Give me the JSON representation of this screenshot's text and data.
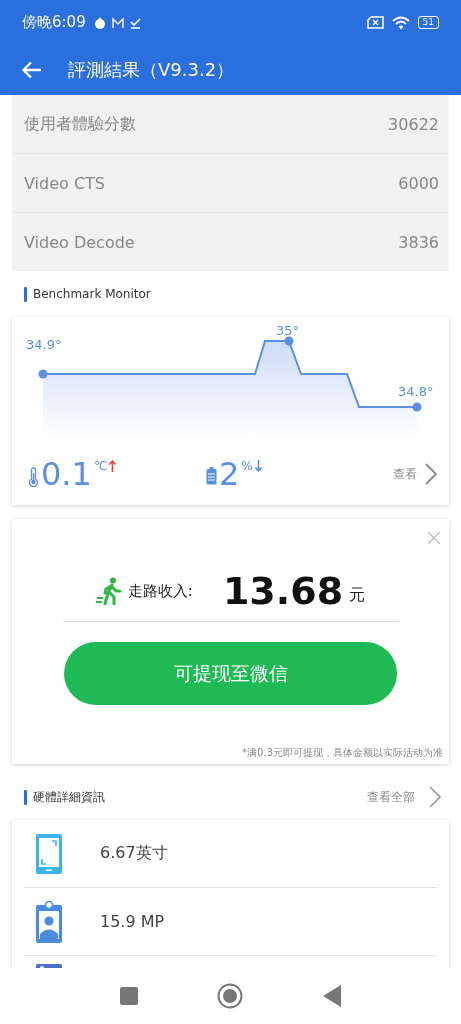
{
  "status_bar": {
    "time": "傍晚6:09",
    "battery": "51"
  },
  "app_bar": {
    "title": "評測結果（V9.3.2）"
  },
  "scores": [
    {
      "label": "使用者體驗分數",
      "value": "30622"
    },
    {
      "label": "Video CTS",
      "value": "6000"
    },
    {
      "label": "Video Decode",
      "value": "3836"
    }
  ],
  "monitor": {
    "heading": "Benchmark Monitor",
    "labels": [
      "34.9°",
      "35°",
      "34.8°"
    ],
    "stats": [
      {
        "kind": "temperature",
        "value": "0.1",
        "unit": "℃",
        "rising": true
      },
      {
        "kind": "battery",
        "value": "2",
        "unit": "%",
        "rising": false
      }
    ],
    "link": "查看"
  },
  "reward": {
    "label": "走路收入:",
    "amount": "13.68",
    "currency": "元",
    "button": "可提现至微信",
    "note": "*满0.3元即可提现，具体金额以实际活动为准"
  },
  "hardware": {
    "heading": "硬體詳細資訊",
    "link": "查看全部",
    "items": [
      {
        "kind": "screen",
        "text": "6.67英寸"
      },
      {
        "kind": "camera",
        "text": "15.9 MP"
      },
      {
        "kind": "other"
      }
    ]
  }
}
